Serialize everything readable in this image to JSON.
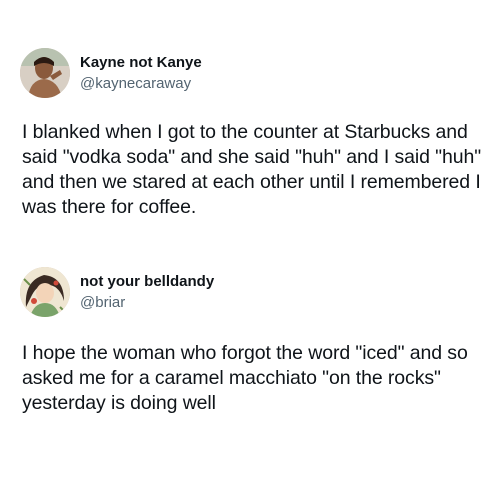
{
  "tweets": [
    {
      "display_name": "Kayne not Kanye",
      "handle": "@kaynecaraway",
      "avatar_icon": "profile-photo-avatar",
      "text": "I blanked when I got to the counter at Starbucks and said \"vodka soda\" and she said \"huh\" and I said \"huh\" and then we stared at each other until I remembered I was there for coffee."
    },
    {
      "display_name": "not your belldandy",
      "handle": "@briar",
      "avatar_icon": "illustrated-character-avatar",
      "text": "I hope the woman who forgot the word \"iced\" and so asked me for a caramel macchiato \"on the rocks\" yesterday is doing well"
    }
  ],
  "colors": {
    "text_primary": "#0f1419",
    "text_secondary": "#536471",
    "background": "#ffffff"
  }
}
